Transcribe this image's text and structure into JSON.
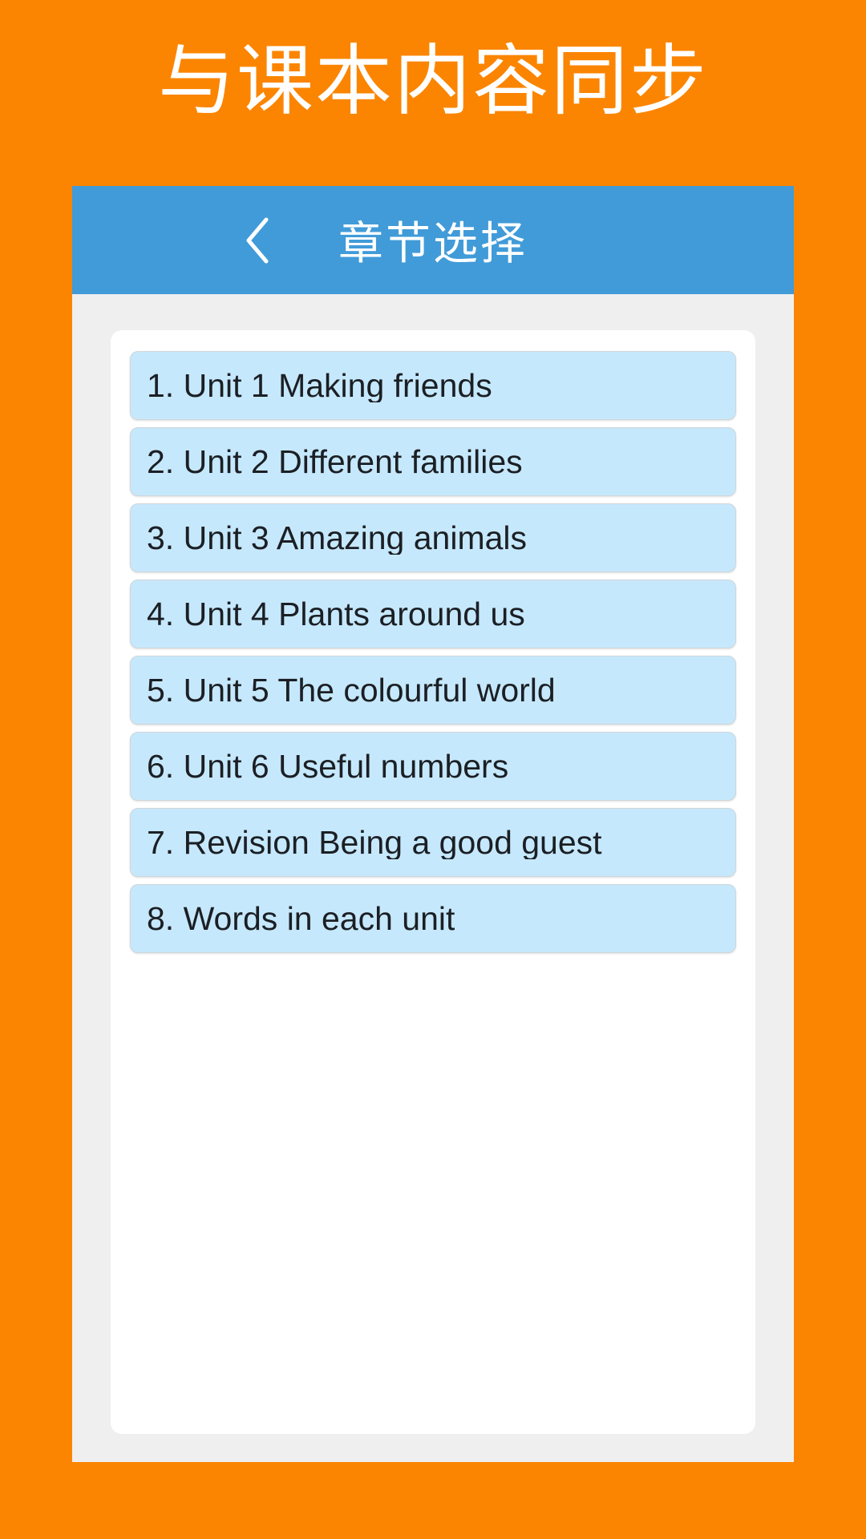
{
  "promo": {
    "headline": "与课本内容同步"
  },
  "colors": {
    "background_orange": "#fb8500",
    "appbar_blue": "#419bd8",
    "item_blue": "#c6e8fc",
    "surface_gray": "#efefef",
    "card_white": "#ffffff",
    "text_dark": "#1b1f24",
    "text_light": "#ffffff"
  },
  "appbar": {
    "back_icon": "chevron-left-icon",
    "title": "章节选择"
  },
  "chapter_list": {
    "items": [
      {
        "label": "1. Unit 1 Making friends"
      },
      {
        "label": "2. Unit 2 Different families"
      },
      {
        "label": "3. Unit 3 Amazing animals"
      },
      {
        "label": "4. Unit 4 Plants around us"
      },
      {
        "label": "5. Unit 5 The colourful world"
      },
      {
        "label": "6. Unit 6 Useful numbers"
      },
      {
        "label": "7. Revision Being a good guest"
      },
      {
        "label": "8. Words in each unit"
      }
    ]
  }
}
